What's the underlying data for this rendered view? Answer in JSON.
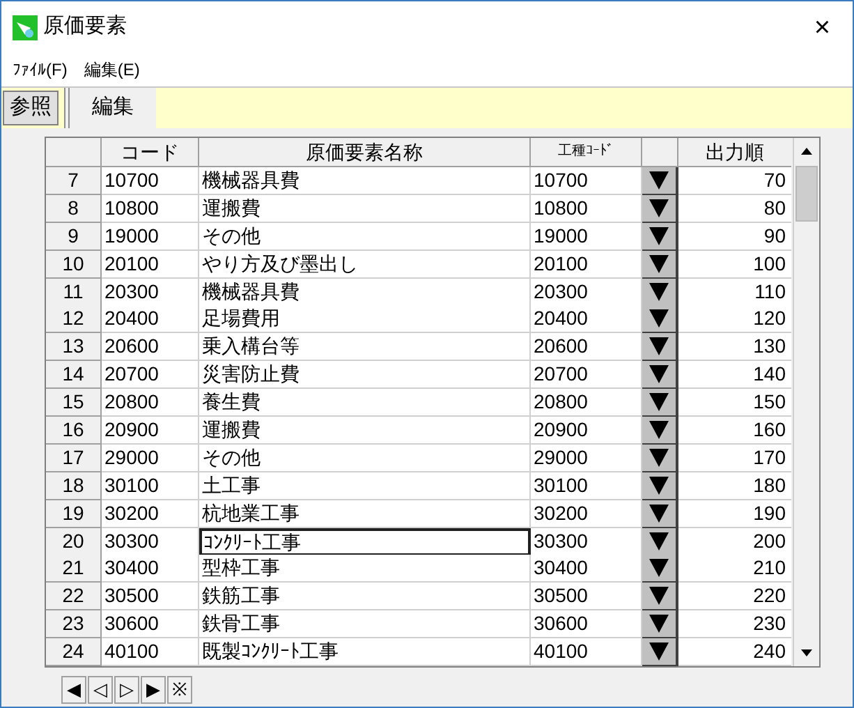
{
  "window": {
    "title": "原価要素",
    "close": "×"
  },
  "menu": [
    "ﾌｧｲﾙ(F)",
    "編集(E)"
  ],
  "tabs": [
    {
      "label": "参照",
      "selected": false
    },
    {
      "label": "編集",
      "selected": true
    }
  ],
  "table": {
    "columns": [
      "コード",
      "原価要素名称",
      "工種ｺｰﾄﾞ",
      "出力順"
    ],
    "rows": [
      {
        "num": "7",
        "code": "10700",
        "name": "機械器具費",
        "work_code": "10700",
        "order": "70",
        "selected": false
      },
      {
        "num": "8",
        "code": "10800",
        "name": "運搬費",
        "work_code": "10800",
        "order": "80",
        "selected": false
      },
      {
        "num": "9",
        "code": "19000",
        "name": "その他",
        "work_code": "19000",
        "order": "90",
        "selected": false
      },
      {
        "num": "10",
        "code": "20100",
        "name": "やり方及び墨出し",
        "work_code": "20100",
        "order": "100",
        "selected": false
      },
      {
        "num": "11",
        "code": "20300",
        "name": "機械器具費",
        "work_code": "20300",
        "order": "110",
        "selected": false
      },
      {
        "num": "12",
        "code": "20400",
        "name": "足場費用",
        "work_code": "20400",
        "order": "120",
        "selected": false
      },
      {
        "num": "13",
        "code": "20600",
        "name": "乗入構台等",
        "work_code": "20600",
        "order": "130",
        "selected": false
      },
      {
        "num": "14",
        "code": "20700",
        "name": "災害防止費",
        "work_code": "20700",
        "order": "140",
        "selected": false
      },
      {
        "num": "15",
        "code": "20800",
        "name": "養生費",
        "work_code": "20800",
        "order": "150",
        "selected": false
      },
      {
        "num": "16",
        "code": "20900",
        "name": "運搬費",
        "work_code": "20900",
        "order": "160",
        "selected": false
      },
      {
        "num": "17",
        "code": "29000",
        "name": "その他",
        "work_code": "29000",
        "order": "170",
        "selected": false
      },
      {
        "num": "18",
        "code": "30100",
        "name": "土工事",
        "work_code": "30100",
        "order": "180",
        "selected": false
      },
      {
        "num": "19",
        "code": "30200",
        "name": "杭地業工事",
        "work_code": "30200",
        "order": "190",
        "selected": false
      },
      {
        "num": "20",
        "code": "30300",
        "name": "ｺﾝｸﾘｰﾄ工事",
        "work_code": "30300",
        "order": "200",
        "selected": true
      },
      {
        "num": "21",
        "code": "30400",
        "name": "型枠工事",
        "work_code": "30400",
        "order": "210",
        "selected": false
      },
      {
        "num": "22",
        "code": "30500",
        "name": "鉄筋工事",
        "work_code": "30500",
        "order": "220",
        "selected": false
      },
      {
        "num": "23",
        "code": "30600",
        "name": "鉄骨工事",
        "work_code": "30600",
        "order": "230",
        "selected": false
      },
      {
        "num": "24",
        "code": "40100",
        "name": "既製ｺﾝｸﾘｰﾄ工事",
        "work_code": "40100",
        "order": "240",
        "selected": false
      }
    ]
  },
  "nav_buttons": [
    "◀",
    "◁",
    "▷",
    "▶",
    "※"
  ]
}
